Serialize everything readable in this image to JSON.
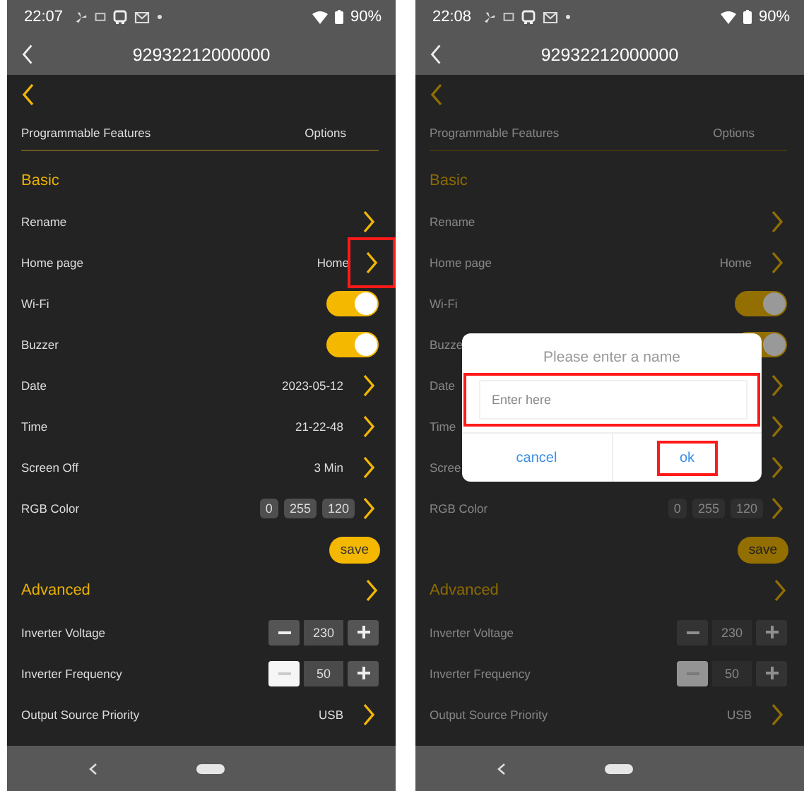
{
  "phones": [
    {
      "status_bar": {
        "time": "22:07",
        "battery": "90%"
      },
      "title": "92932212000000",
      "header": {
        "feature": "Programmable Features",
        "options": "Options"
      },
      "dimmed": false,
      "rows": [
        {
          "kind": "section",
          "label": "Basic",
          "chevron": false
        },
        {
          "kind": "link",
          "label": "Rename",
          "highlighted": false
        },
        {
          "kind": "link",
          "label": "Home page",
          "value": "Home",
          "highlighted": true
        },
        {
          "kind": "toggle",
          "label": "Wi-Fi",
          "on": true
        },
        {
          "kind": "toggle",
          "label": "Buzzer",
          "on": true
        },
        {
          "kind": "link",
          "label": "Date",
          "value": "2023-05-12",
          "highlighted": false
        },
        {
          "kind": "link",
          "label": "Time",
          "value": "21-22-48",
          "highlighted": false
        },
        {
          "kind": "link",
          "label": "Screen Off",
          "value": "3 Min",
          "highlighted": false
        },
        {
          "kind": "rgb",
          "label": "RGB Color",
          "values": [
            "0",
            "255",
            "120"
          ]
        },
        {
          "kind": "save",
          "label": "save"
        },
        {
          "kind": "section",
          "label": "Advanced",
          "chevron": true
        },
        {
          "kind": "stepper",
          "label": "Inverter Voltage",
          "value": "230",
          "minus_pressed": false
        },
        {
          "kind": "stepper",
          "label": "Inverter Frequency",
          "value": "50",
          "minus_pressed": true
        },
        {
          "kind": "link",
          "label": "Output Source Priority",
          "value": "USB",
          "highlighted": false
        }
      ]
    },
    {
      "status_bar": {
        "time": "22:08",
        "battery": "90%"
      },
      "title": "92932212000000",
      "header": {
        "feature": "Programmable Features",
        "options": "Options"
      },
      "dimmed": true,
      "rows": [
        {
          "kind": "section",
          "label": "Basic",
          "chevron": false
        },
        {
          "kind": "link",
          "label": "Rename",
          "highlighted": false
        },
        {
          "kind": "link",
          "label": "Home page",
          "value": "Home",
          "highlighted": false
        },
        {
          "kind": "toggle",
          "label": "Wi-Fi",
          "on": true
        },
        {
          "kind": "toggle",
          "label": "Buzze",
          "on": true
        },
        {
          "kind": "link",
          "label": "Date",
          "highlighted": false
        },
        {
          "kind": "link",
          "label": "Time",
          "highlighted": false
        },
        {
          "kind": "link",
          "label": "Scree",
          "highlighted": false
        },
        {
          "kind": "rgb",
          "label": "RGB Color",
          "values": [
            "0",
            "255",
            "120"
          ]
        },
        {
          "kind": "save",
          "label": "save"
        },
        {
          "kind": "section",
          "label": "Advanced",
          "chevron": true
        },
        {
          "kind": "stepper",
          "label": "Inverter Voltage",
          "value": "230",
          "minus_pressed": false
        },
        {
          "kind": "stepper",
          "label": "Inverter Frequency",
          "value": "50",
          "minus_pressed": true
        },
        {
          "kind": "link",
          "label": "Output Source Priority",
          "value": "USB",
          "highlighted": false
        }
      ],
      "dialog": {
        "title": "Please enter a name",
        "placeholder": "Enter here",
        "field_highlighted": true,
        "buttons": [
          {
            "label": "cancel",
            "highlighted": false
          },
          {
            "label": "ok",
            "highlighted": true
          }
        ]
      }
    }
  ]
}
